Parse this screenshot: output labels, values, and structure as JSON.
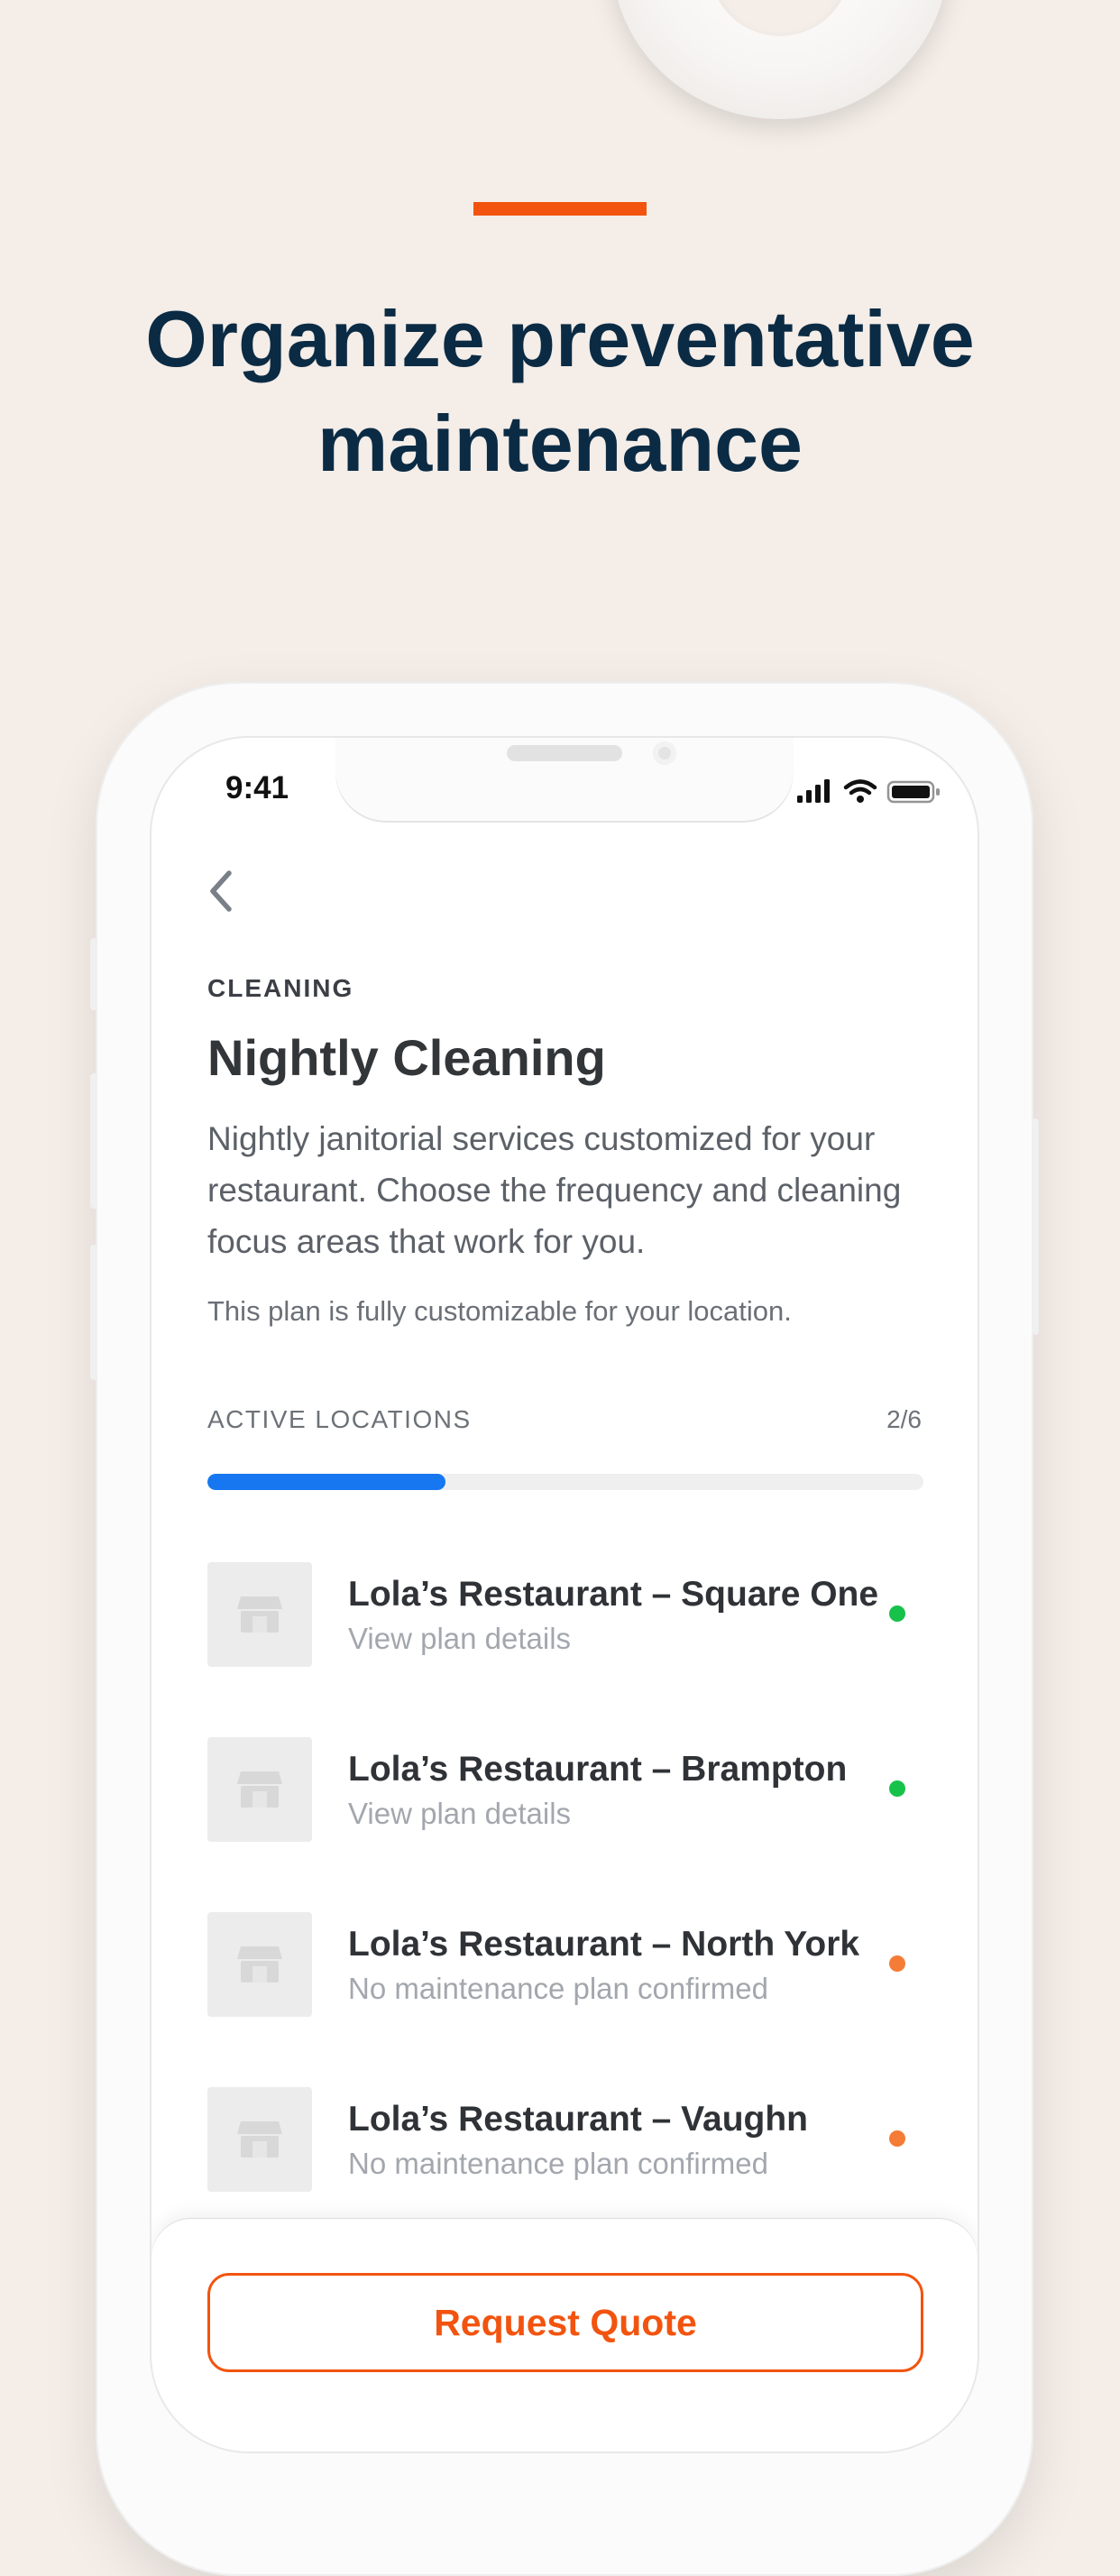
{
  "marketing": {
    "headline_line1": "Organize preventative",
    "headline_line2": "maintenance"
  },
  "status_bar": {
    "time": "9:41"
  },
  "service": {
    "category": "CLEANING",
    "title": "Nightly Cleaning",
    "description": "Nightly janitorial services customized for your restaurant. Choose the frequency and cleaning focus areas that work for you.",
    "note": "This plan is fully customizable for your location."
  },
  "locations": {
    "label": "ACTIVE LOCATIONS",
    "count": "2/6",
    "progress": 0.333,
    "items": [
      {
        "name": "Lola’s Restaurant – Square One",
        "subtitle": "View plan details",
        "status": "active",
        "status_color": "#17c24b"
      },
      {
        "name": "Lola’s Restaurant – Brampton",
        "subtitle": "View plan details",
        "status": "active",
        "status_color": "#17c24b"
      },
      {
        "name": "Lola’s Restaurant – North York",
        "subtitle": "No maintenance plan confirmed",
        "status": "unconfirmed",
        "status_color": "#f57c36"
      },
      {
        "name": "Lola’s Restaurant – Vaughn",
        "subtitle": "No maintenance plan confirmed",
        "status": "unconfirmed",
        "status_color": "#f57c36"
      }
    ]
  },
  "actions": {
    "request_quote": "Request Quote"
  },
  "colors": {
    "accent": "#f2540f",
    "headline": "#0b2b44",
    "progress": "#1677f0",
    "background": "#f4ede8"
  },
  "icons": {
    "back": "chevron-left-icon",
    "signal": "cellular-signal-icon",
    "wifi": "wifi-icon",
    "battery": "battery-icon",
    "store": "storefront-icon"
  }
}
